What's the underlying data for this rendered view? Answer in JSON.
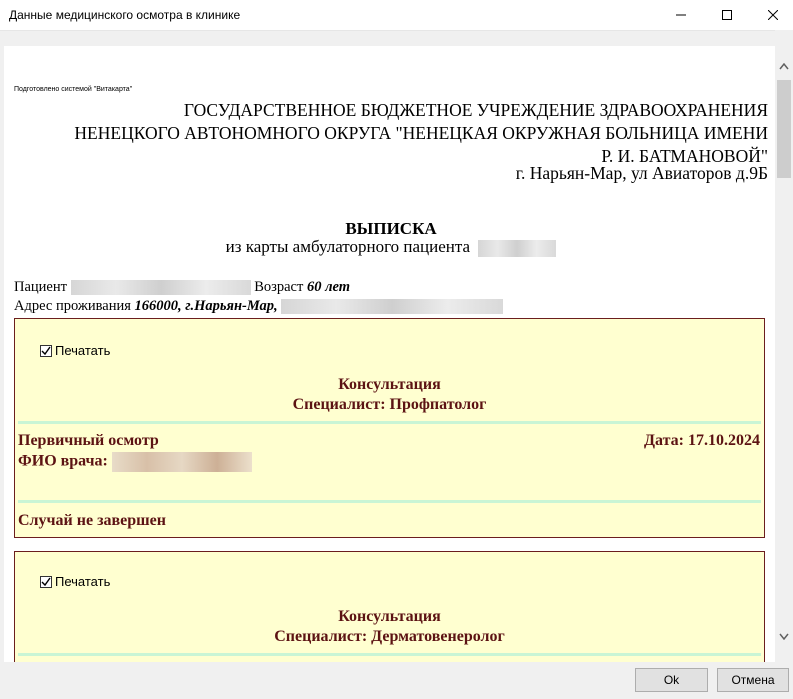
{
  "window": {
    "title": "Данные медицинского осмотра в клинике"
  },
  "document": {
    "prepared_by": "Подготовлено системой \"Витакарта\"",
    "org_line1": "ГОСУДАРСТВЕННОЕ БЮДЖЕТНОЕ УЧРЕЖДЕНИЕ ЗДРАВООХРАНЕНИЯ",
    "org_line2": "НЕНЕЦКОГО АВТОНОМНОГО ОКРУГА \"НЕНЕЦКАЯ ОКРУЖНАЯ БОЛЬНИЦА ИМЕНИ",
    "org_line3": "Р. И. БАТМАНОВОЙ\"",
    "address": "г. Нарьян-Мар, ул Авиаторов д.9Б",
    "title": "ВЫПИСКА",
    "subtitle": "из карты амбулаторного пациента",
    "patient_label": "Пациент",
    "age_label": "Возраст",
    "age_value": "60 лет",
    "residence_label": "Адрес проживания",
    "residence_value": "166000, г.Нарьян-Мар,"
  },
  "consultations": [
    {
      "print_label": "Печатать",
      "print_checked": true,
      "type": "Консультация",
      "specialist": "Специалист: Профпатолог",
      "exam_type": "Первичный осмотр",
      "date": "Дата: 17.10.2024",
      "doctor_label": "ФИО врача:",
      "status": "Случай не завершен"
    },
    {
      "print_label": "Печатать",
      "print_checked": true,
      "type": "Консультация",
      "specialist": "Специалист: Дерматовенеролог"
    }
  ],
  "buttons": {
    "ok": "Ok",
    "cancel": "Отмена"
  },
  "colors": {
    "card_bg": "#ffffd0",
    "card_text": "#5c1313",
    "separator": "#c9f5d5"
  }
}
